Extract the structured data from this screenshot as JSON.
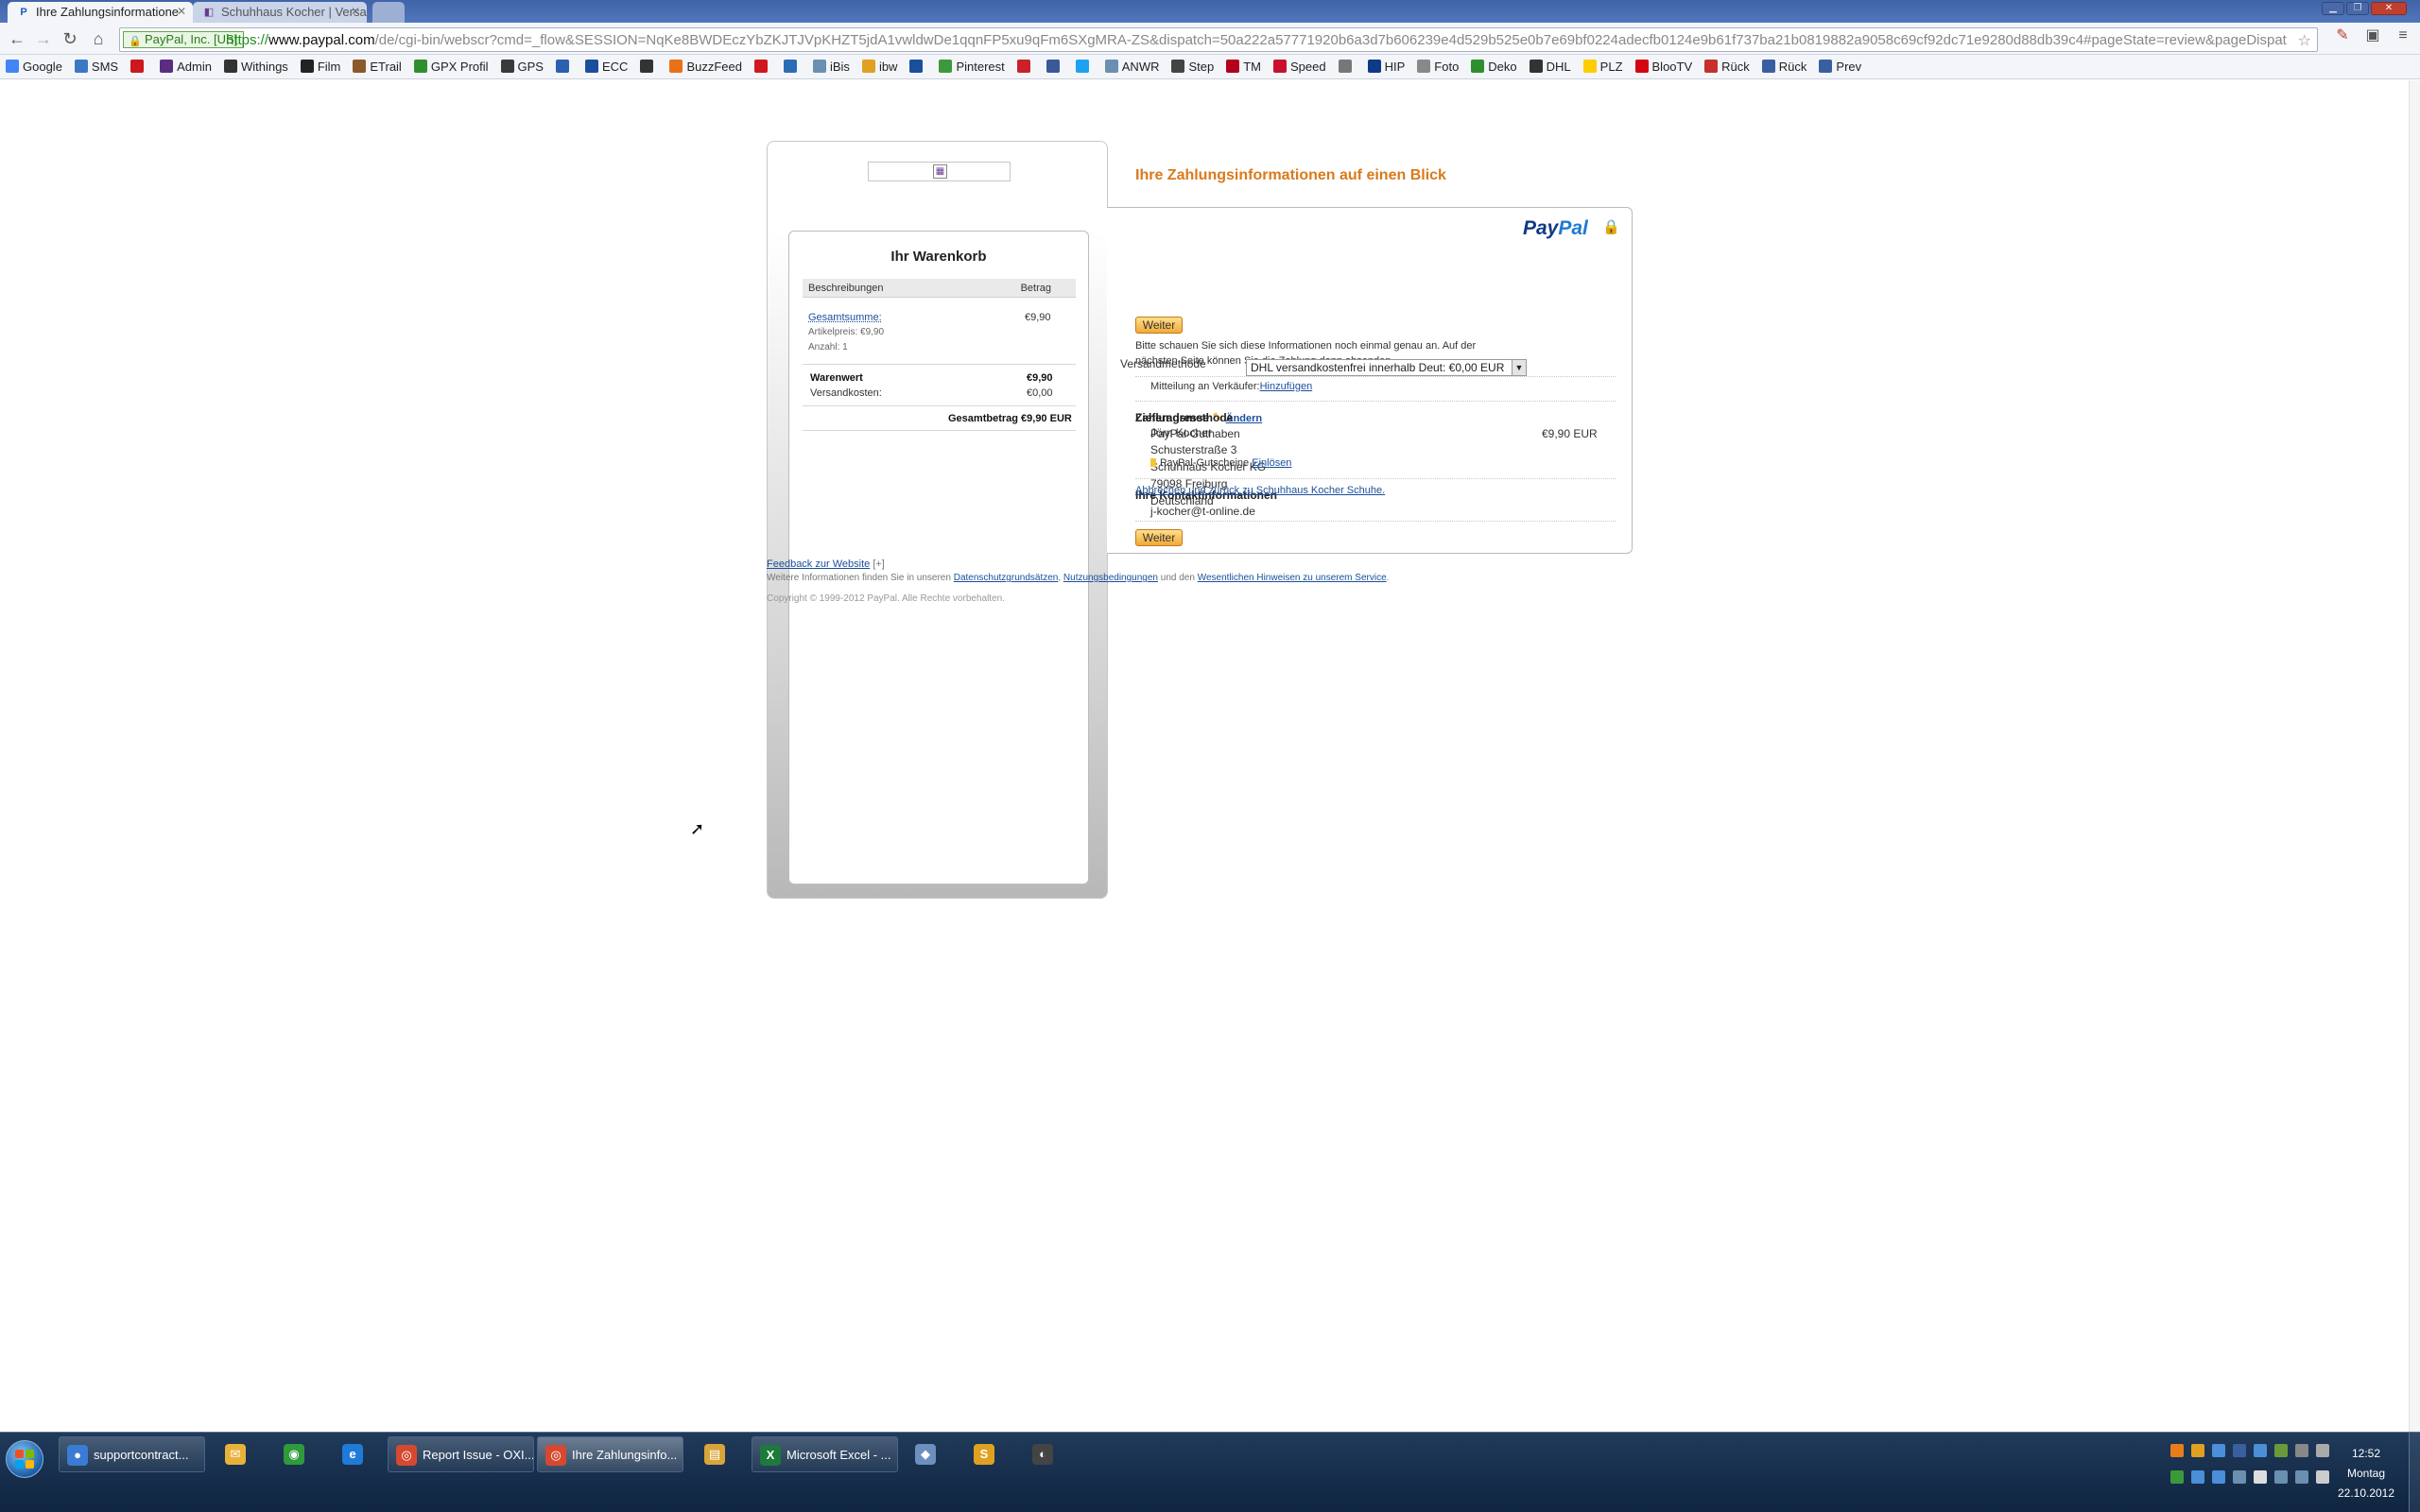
{
  "browser": {
    "tabs": [
      {
        "title": "Ihre Zahlungsinformatione",
        "favicon": "paypal-icon"
      },
      {
        "title": "Schuhhaus Kocher | Versan",
        "favicon": "shop-icon"
      }
    ],
    "ev_label": "PayPal, Inc. [US]",
    "url_scheme": "https://",
    "url_host": "www.paypal.com",
    "url_path": "/de/cgi-bin/webscr?cmd=_flow&SESSION=NqKe8BWDEczYbZKJTJVpKHZT5jdA1vwldwDe1qqnFP5xu9qFm6SXgMRA-ZS&dispatch=50a222a57771920b6a3d7b606239e4d529b525e0b7e69bf0224adecfb0124e9b61f737ba21b0819882a9058c69cf92dc71e9280d88db39c4#pageState=review&pageDispatch=50a",
    "bookmarks": [
      "Google",
      "SMS",
      "",
      "Admin",
      "Withings",
      "Film",
      "ETrail",
      "GPX Profil",
      "GPS",
      "",
      "ECC",
      "",
      "BuzzFeed",
      "",
      "",
      "iBis",
      "ibw",
      "",
      "Pinterest",
      "",
      "",
      "",
      "ANWR",
      "Step",
      "TM",
      "Speed",
      "",
      "HIP",
      "Foto",
      "Deko",
      "DHL",
      "PLZ",
      "BlooTV",
      "Rück",
      "Rück",
      "Prev"
    ]
  },
  "cart": {
    "title": "Ihr Warenkorb",
    "col_desc": "Beschreibungen",
    "col_amount": "Betrag",
    "item_name": "Gesamtsumme:",
    "item_price_label": "Artikelpreis: €9,90",
    "item_qty_label": "Anzahl: 1",
    "item_amount": "€9,90",
    "subtotal_label": "Warenwert",
    "subtotal_value": "€9,90",
    "shipping_label": "Versandkosten:",
    "shipping_value": "€0,00",
    "total": "Gesamtbetrag €9,90 EUR"
  },
  "review": {
    "heading": "Ihre Zahlungsinformationen auf einen Blick",
    "logo_pay": "Pay",
    "logo_pal": "Pal",
    "continue_label": "Weiter",
    "intro_line1": "Bitte schauen Sie sich diese Informationen noch einmal genau an. Auf der",
    "intro_line2": "nächsten Seite können Sie die Zahlung dann absenden.",
    "address_heading": "Lieferadresse",
    "change_link": "Ändern",
    "address": [
      "Jörn Kocher",
      "Schusterstraße 3",
      "Schuhhaus Kocher KG",
      "79098 Freiburg",
      "Deutschland"
    ],
    "shipping_method_label": "Versandmethode",
    "shipping_method_value": "DHL versandkostenfrei innerhalb Deut: €0,00 EUR",
    "seller_note_label": "Mitteilung an Verkäufer:",
    "seller_note_link": "Hinzufügen",
    "payment_heading": "Zahlungsmethode",
    "payment_source": "PayPal-Guthaben",
    "payment_amount": "€9,90 EUR",
    "coupon_label": "PayPal-Gutscheine",
    "coupon_link": "Einlösen",
    "contact_heading": "Ihre Kontaktinformationen",
    "contact_email": "j-kocher@t-online.de"
  },
  "cancel_link": "Abbrechen und zurück zu Schuhhaus Kocher Schuhe.",
  "footer": {
    "feedback_link": "Feedback zur Website",
    "feedback_suffix": "[+]",
    "info_prefix": "Weitere Informationen finden Sie in unseren",
    "privacy_link": "Datenschutzgrundsätzen",
    "terms_link": "Nutzungsbedingungen",
    "info_mid": "und den",
    "notes_link": "Wesentlichen Hinweisen zu unserem Service",
    "copyright": "Copyright © 1999-2012 PayPal. Alle Rechte vorbehalten."
  },
  "taskbar": {
    "windows": [
      {
        "label": "supportcontract..."
      },
      {
        "label": "Report Issue - OXI..."
      },
      {
        "label": "Ihre Zahlungsinfo..."
      },
      {
        "label": "Microsoft Excel - ..."
      }
    ],
    "clock_time": "12:52",
    "clock_day": "Montag",
    "clock_date": "22.10.2012"
  },
  "colors": {
    "accent_heading": "#d97a1b",
    "link": "#1a4f9c",
    "button_top": "#ffe08a",
    "button_bottom": "#f2a93a"
  }
}
